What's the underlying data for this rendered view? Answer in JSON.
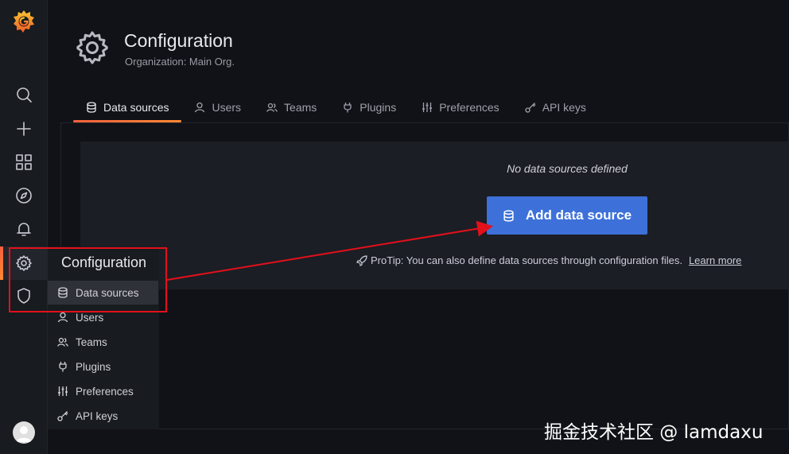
{
  "sidebar": {
    "items": [
      {
        "name": "search",
        "icon": "search-icon"
      },
      {
        "name": "create",
        "icon": "plus-icon"
      },
      {
        "name": "dashboards",
        "icon": "apps-grid-icon"
      },
      {
        "name": "explore",
        "icon": "compass-icon"
      },
      {
        "name": "alerting",
        "icon": "bell-icon"
      },
      {
        "name": "configuration",
        "icon": "gear-icon",
        "active": true
      },
      {
        "name": "server-admin",
        "icon": "shield-icon"
      }
    ]
  },
  "header": {
    "title": "Configuration",
    "subtitle": "Organization: Main Org."
  },
  "tabs": [
    {
      "label": "Data sources",
      "icon": "database-icon",
      "active": true
    },
    {
      "label": "Users",
      "icon": "user-icon"
    },
    {
      "label": "Teams",
      "icon": "users-icon"
    },
    {
      "label": "Plugins",
      "icon": "plug-icon"
    },
    {
      "label": "Preferences",
      "icon": "sliders-icon"
    },
    {
      "label": "API keys",
      "icon": "key-icon"
    }
  ],
  "empty_state": {
    "message": "No data sources defined",
    "button_label": "Add data source",
    "protip": "ProTip: You can also define data sources through configuration files.",
    "learn_more": "Learn more"
  },
  "menu": {
    "title": "Configuration",
    "items": [
      {
        "label": "Data sources",
        "icon": "database-icon",
        "active": true
      },
      {
        "label": "Users",
        "icon": "user-icon"
      },
      {
        "label": "Teams",
        "icon": "users-icon"
      },
      {
        "label": "Plugins",
        "icon": "plug-icon"
      },
      {
        "label": "Preferences",
        "icon": "sliders-icon"
      },
      {
        "label": "API keys",
        "icon": "key-icon"
      }
    ]
  },
  "watermark": "掘金技术社区 @ lamdaxu",
  "colors": {
    "accent": "#3d71d9",
    "highlight": "#e3101b",
    "tab_underline": "#f55f3e"
  }
}
